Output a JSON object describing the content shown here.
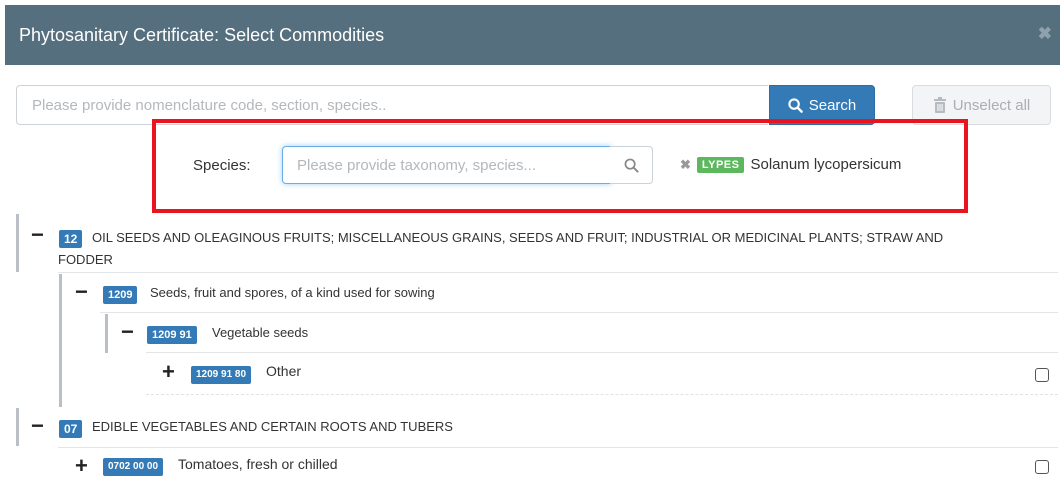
{
  "dialog": {
    "title": "Phytosanitary Certificate: Select Commodities",
    "close_icon": "close-icon"
  },
  "search": {
    "placeholder": "Please provide nomenclature code, section, species..",
    "button_label": "Search",
    "unselect_label": "Unselect all"
  },
  "species_filter": {
    "label": "Species:",
    "placeholder": "Please provide taxonomy, species...",
    "selected_tag": {
      "code": "LYPES",
      "name": "Solanum lycopersicum"
    }
  },
  "tree": {
    "n12": {
      "code": "12",
      "label": "OIL SEEDS AND OLEAGINOUS FRUITS; MISCELLANEOUS GRAINS, SEEDS AND FRUIT; INDUSTRIAL OR MEDICINAL PLANTS; STRAW AND",
      "label_cont": "FODDER",
      "expanded": true
    },
    "n1209": {
      "code": "1209",
      "label": "Seeds, fruit and spores, of a kind used for sowing",
      "expanded": true
    },
    "n120991": {
      "code": "1209 91",
      "label": "Vegetable seeds",
      "expanded": true
    },
    "n12099180": {
      "code": "1209 91 80",
      "label": "Other",
      "expanded": false,
      "checked": false
    },
    "n07": {
      "code": "07",
      "label": "EDIBLE VEGETABLES AND CERTAIN ROOTS AND TUBERS",
      "expanded": true
    },
    "n07020000": {
      "code": "0702 00 00",
      "label": "Tomatoes, fresh or chilled",
      "expanded": false,
      "checked": false
    }
  },
  "colors": {
    "header": "#566f7e",
    "primary": "#337ab7",
    "tag": "#5cb85c",
    "highlight": "#e8141f"
  }
}
